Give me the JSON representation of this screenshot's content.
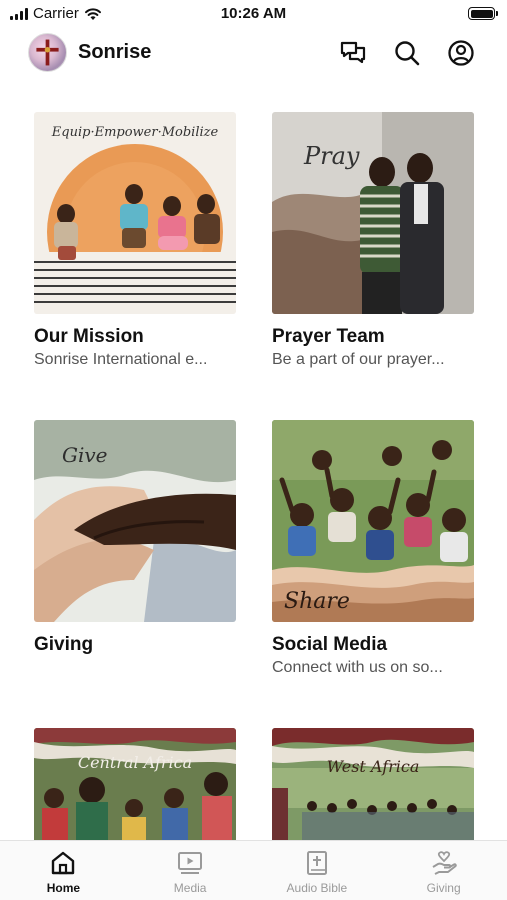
{
  "status_bar": {
    "carrier": "Carrier",
    "time": "10:26 AM"
  },
  "header": {
    "title": "Sonrise",
    "icons": [
      "chat-bubbles-icon",
      "search-icon",
      "account-icon"
    ]
  },
  "cards": [
    {
      "title": "Our Mission",
      "subtitle": "Sonrise International e...",
      "image_text": "Equip·Empower·Mobilize"
    },
    {
      "title": "Prayer Team",
      "subtitle": "Be a part of our prayer...",
      "image_text": "Pray"
    },
    {
      "title": "Giving",
      "subtitle": "",
      "image_text": "Give"
    },
    {
      "title": "Social Media",
      "subtitle": "Connect with us on so...",
      "image_text": "Share"
    },
    {
      "title": "",
      "subtitle": "",
      "image_text": "Central Africa"
    },
    {
      "title": "",
      "subtitle": "",
      "image_text": "West Africa"
    }
  ],
  "tabs": [
    {
      "label": "Home",
      "icon": "home-icon",
      "active": true
    },
    {
      "label": "Media",
      "icon": "media-icon",
      "active": false
    },
    {
      "label": "Audio Bible",
      "icon": "bible-icon",
      "active": false
    },
    {
      "label": "Giving",
      "icon": "giving-hand-icon",
      "active": false
    }
  ],
  "colors": {
    "text": "#111111",
    "subtitle": "#555555",
    "tab_inactive": "#9a9a9a",
    "tab_active": "#111111"
  }
}
